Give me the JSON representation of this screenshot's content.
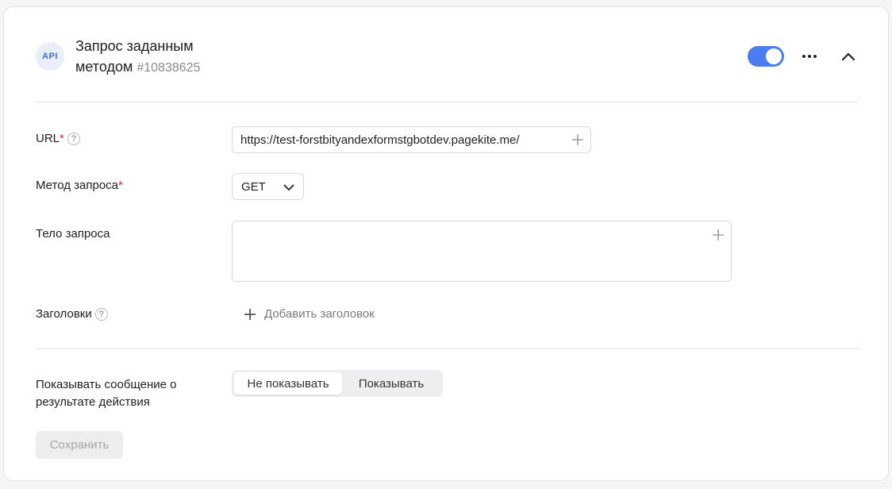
{
  "header": {
    "badge": "API",
    "title_line1": "Запрос заданным",
    "title_line2": "методом",
    "action_id": "#10838625",
    "enabled": true
  },
  "form": {
    "url_label": "URL",
    "url_required_mark": "*",
    "url_value": "https://test-forstbityandexformstgbotdev.pagekite.me/",
    "method_label": "Метод запроса",
    "method_required_mark": "*",
    "method_value": "GET",
    "body_label": "Тело запроса",
    "body_value": "",
    "headers_label": "Заголовки",
    "add_header_label": "Добавить заголовок",
    "help_glyph": "?"
  },
  "result_message": {
    "label": "Показывать сообщение о результате действия",
    "options": [
      "Не показывать",
      "Показывать"
    ],
    "selected": "Не показывать"
  },
  "actions": {
    "save_label": "Сохранить"
  },
  "colors": {
    "accent": "#4a7ef0",
    "required": "#e0283c"
  }
}
